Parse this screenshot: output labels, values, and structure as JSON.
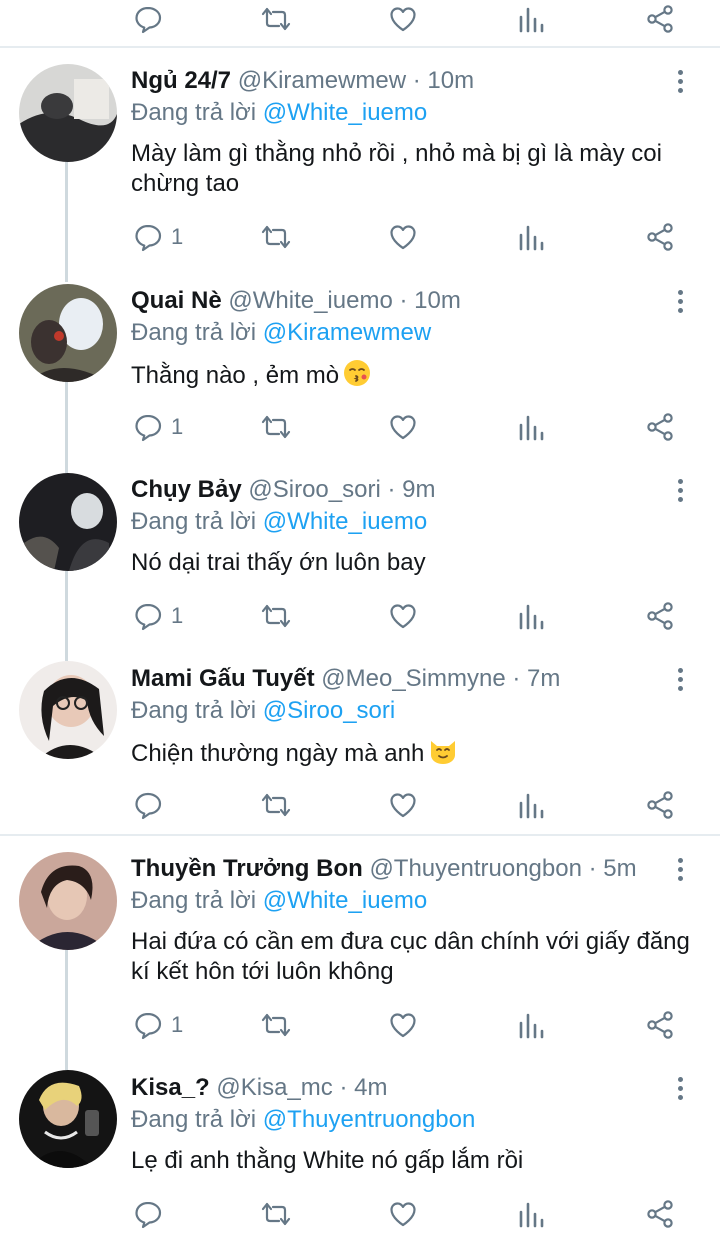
{
  "reply_prefix": "Đang trả lời",
  "top_actions": {
    "reply": "",
    "retweet": "",
    "like": ""
  },
  "tweets": [
    {
      "name": "Ngủ 24/7",
      "handle": "@Kiramewmew",
      "time": "· 10m",
      "reply_to": "@White_iuemo",
      "text": "Mày làm gì thằng nhỏ rồi , nhỏ mà bị gì là mày coi chừng tao",
      "reply_count": "1",
      "emoji": ""
    },
    {
      "name": "Quai Nè",
      "handle": "@White_iuemo",
      "time": "· 10m",
      "reply_to": "@Kiramewmew",
      "text": "Thằng nào , ẻm mò",
      "reply_count": "1",
      "emoji": "kissing-face-emoji"
    },
    {
      "name": "Chụy Bảy",
      "handle": "@Siroo_sori",
      "time": "· 9m",
      "reply_to": "@White_iuemo",
      "text": "Nó dại trai thấy ớn luôn bay",
      "reply_count": "1",
      "emoji": ""
    },
    {
      "name": "Mami Gấu Tuyết",
      "handle": "@Meo_Simmyne",
      "time": "· 7m",
      "reply_to": "@Siroo_sori",
      "text": "Chiện thường ngày mà anh",
      "reply_count": "",
      "emoji": "cat-face-emoji"
    },
    {
      "name": "Thuyền Trưởng Bon",
      "handle": "@Thuyentruongbon",
      "time": "· 5m",
      "reply_to": "@White_iuemo",
      "text": "Hai đứa có cần em đưa cục dân chính với giấy đăng kí kết hôn tới luôn không",
      "reply_count": "1",
      "emoji": ""
    },
    {
      "name": "Kisa_?",
      "handle": "@Kisa_mc",
      "time": "· 4m",
      "reply_to": "@Thuyentruongbon",
      "text": "Lẹ đi anh thằng White nó gấp lắm rồi",
      "reply_count": "",
      "emoji": ""
    }
  ],
  "colors": {
    "accent": "#1da1f2",
    "secondary_text": "#657786",
    "divider": "#e6ecf0"
  }
}
